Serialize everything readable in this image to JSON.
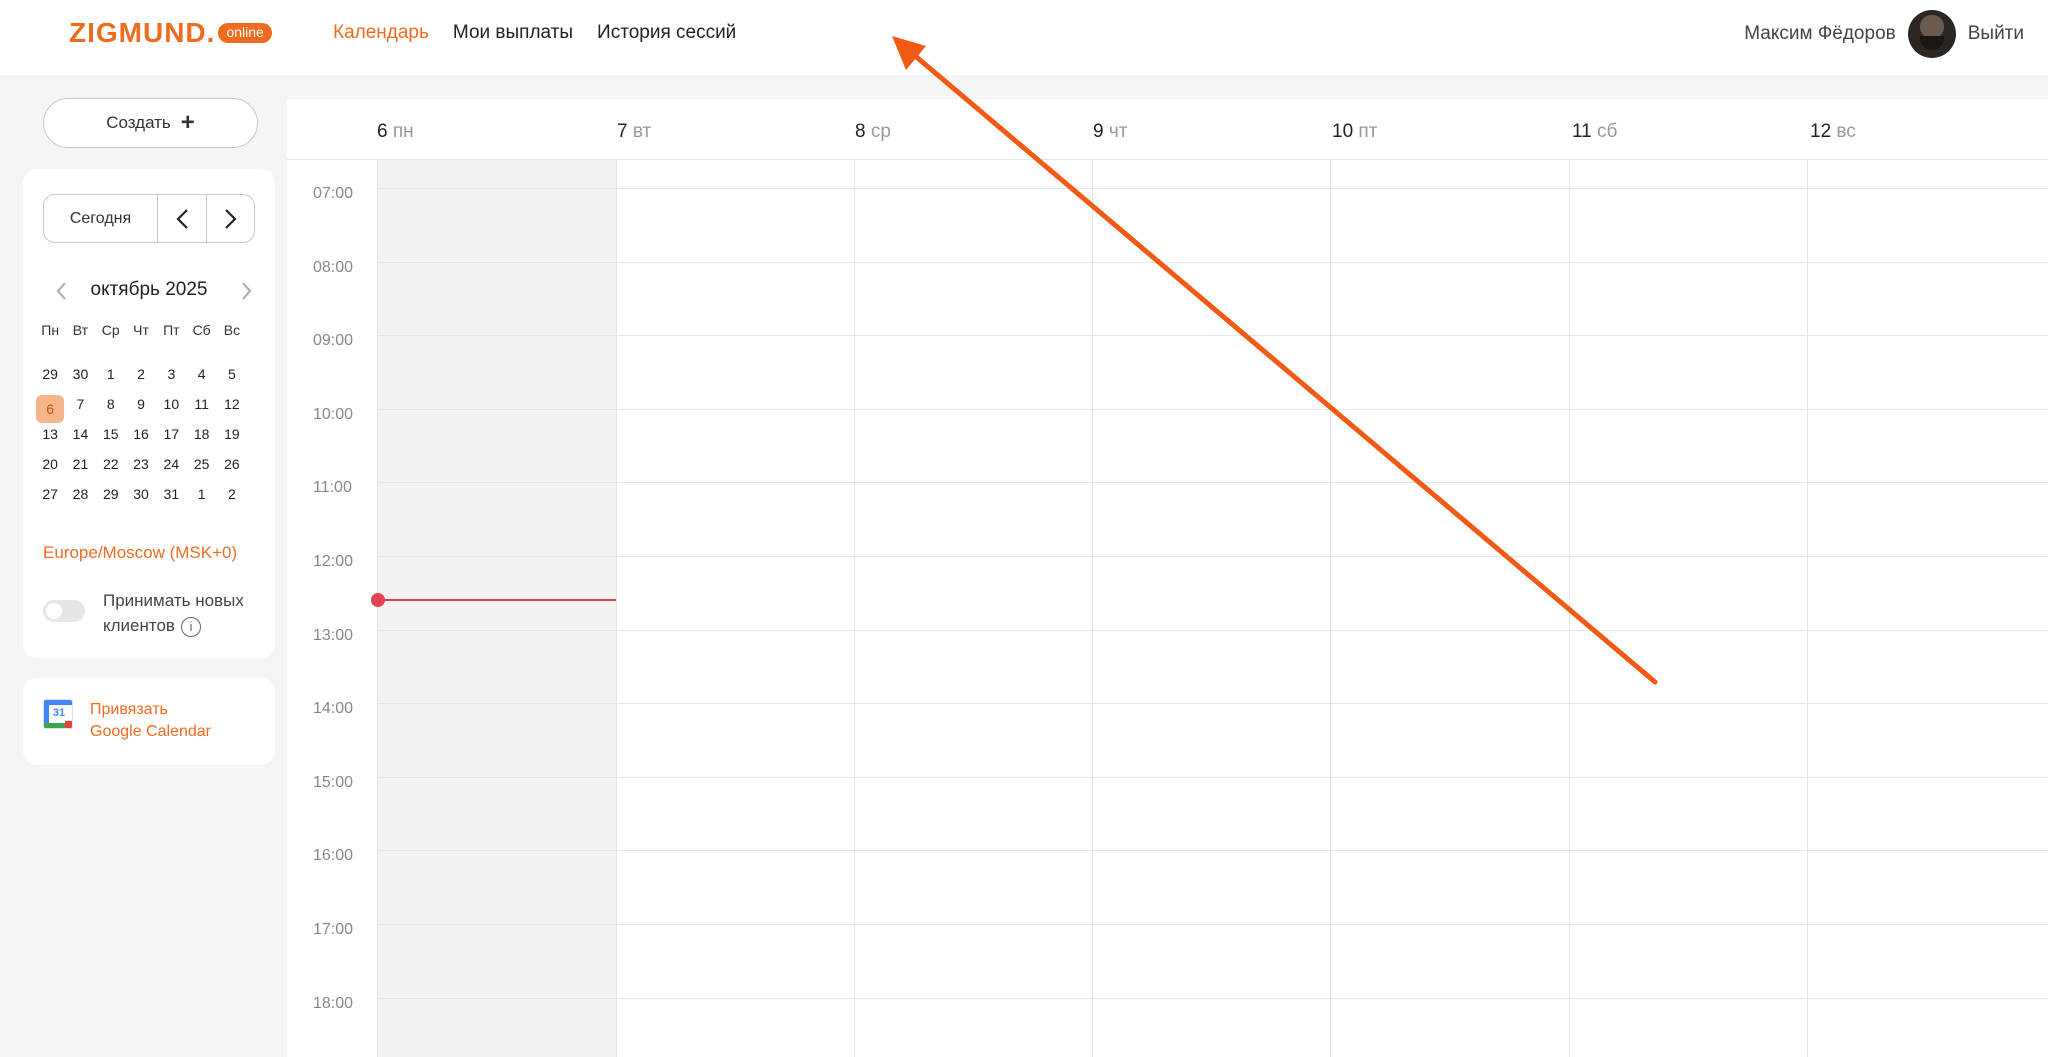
{
  "header": {
    "logo_text": "ZIGMUND.",
    "logo_badge": "online",
    "nav": [
      {
        "label": "Календарь",
        "active": true
      },
      {
        "label": "Мои выплаты",
        "active": false
      },
      {
        "label": "История сессий",
        "active": false
      }
    ],
    "user_name": "Максим Фёдоров",
    "logout_label": "Выйти"
  },
  "sidebar": {
    "create_label": "Создать",
    "today_label": "Сегодня",
    "mini_calendar": {
      "month_title": "октябрь 2025",
      "weekdays": [
        "Пн",
        "Вт",
        "Ср",
        "Чт",
        "Пт",
        "Сб",
        "Вс"
      ],
      "weeks": [
        [
          "29",
          "30",
          "1",
          "2",
          "3",
          "4",
          "5"
        ],
        [
          "6",
          "7",
          "8",
          "9",
          "10",
          "11",
          "12"
        ],
        [
          "13",
          "14",
          "15",
          "16",
          "17",
          "18",
          "19"
        ],
        [
          "20",
          "21",
          "22",
          "23",
          "24",
          "25",
          "26"
        ],
        [
          "27",
          "28",
          "29",
          "30",
          "31",
          "1",
          "2"
        ]
      ],
      "selected_day": "6"
    },
    "timezone": "Europe/Moscow (MSK+0)",
    "accept_clients_label_1": "Принимать новых",
    "accept_clients_label_2": "клиентов",
    "accept_clients_enabled": false,
    "gcal_line1": "Привязать",
    "gcal_line2": "Google Calendar",
    "gcal_icon_number": "31"
  },
  "calendar": {
    "days": [
      {
        "num": "6",
        "dow": "пн"
      },
      {
        "num": "7",
        "dow": "вт"
      },
      {
        "num": "8",
        "dow": "ср"
      },
      {
        "num": "9",
        "dow": "чт"
      },
      {
        "num": "10",
        "dow": "пт"
      },
      {
        "num": "11",
        "dow": "сб"
      },
      {
        "num": "12",
        "dow": "вс"
      }
    ],
    "hours": [
      "07:00",
      "08:00",
      "09:00",
      "10:00",
      "11:00",
      "12:00",
      "13:00",
      "14:00",
      "15:00",
      "16:00",
      "17:00",
      "18:00"
    ],
    "accent_color": "#ee6b1f",
    "now_line_color": "#e0404f"
  },
  "annotation_color": "#f05a14"
}
